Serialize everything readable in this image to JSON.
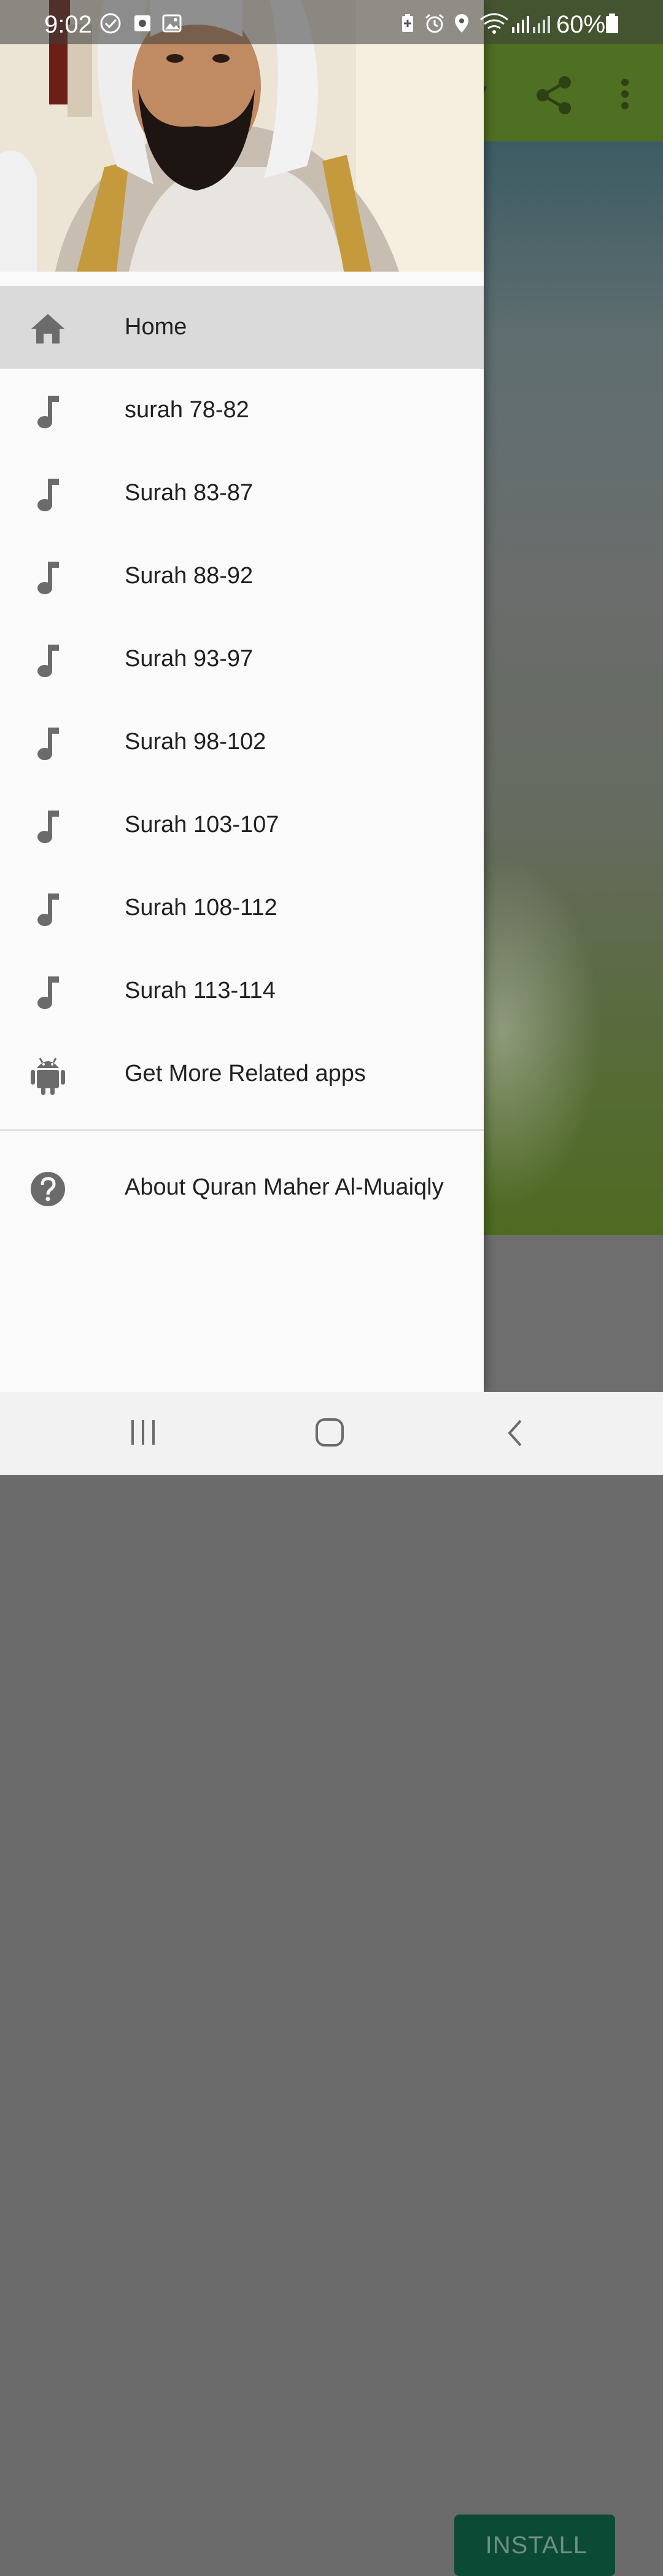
{
  "status_bar": {
    "time": "9:02",
    "battery": "60%"
  },
  "app_bg": {
    "toolbar_title_fragment": "y",
    "install_label": "INSTALL"
  },
  "drawer": {
    "items": [
      {
        "label": "Home",
        "icon": "home-icon",
        "selected": true
      },
      {
        "label": "surah 78-82",
        "icon": "music-note-icon"
      },
      {
        "label": "Surah 83-87",
        "icon": "music-note-icon"
      },
      {
        "label": "Surah 88-92",
        "icon": "music-note-icon"
      },
      {
        "label": "Surah 93-97",
        "icon": "music-note-icon"
      },
      {
        "label": "Surah 98-102",
        "icon": "music-note-icon"
      },
      {
        "label": "Surah 103-107",
        "icon": "music-note-icon"
      },
      {
        "label": "Surah 108-112",
        "icon": "music-note-icon"
      },
      {
        "label": "Surah 113-114",
        "icon": "music-note-icon"
      },
      {
        "label": "Get More Related apps",
        "icon": "android-icon"
      }
    ],
    "about": {
      "label": "About Quran Maher Al-Muaiqly",
      "icon": "help-circle-icon"
    }
  },
  "colors": {
    "toolbar": "#4f6f22",
    "install_button": "#0b4a35",
    "drawer_bg": "#fafafa",
    "selected_bg": "#dadada",
    "icon_gray": "#6b6b6b"
  }
}
